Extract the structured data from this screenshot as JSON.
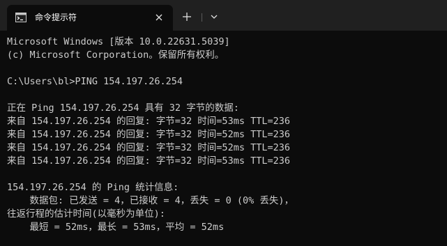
{
  "window": {
    "tab_icon": "terminal-icon",
    "tab_title": "命令提示符",
    "close_icon": "close-icon",
    "new_tab_icon": "plus-icon",
    "dropdown_icon": "chevron-down-icon"
  },
  "console": {
    "lines": [
      "Microsoft Windows [版本 10.0.22631.5039]",
      "(c) Microsoft Corporation。保留所有权利。",
      "",
      "C:\\Users\\bl>PING 154.197.26.254",
      "",
      "正在 Ping 154.197.26.254 具有 32 字节的数据:",
      "来自 154.197.26.254 的回复: 字节=32 时间=53ms TTL=236",
      "来自 154.197.26.254 的回复: 字节=32 时间=52ms TTL=236",
      "来自 154.197.26.254 的回复: 字节=32 时间=52ms TTL=236",
      "来自 154.197.26.254 的回复: 字节=32 时间=53ms TTL=236",
      "",
      "154.197.26.254 的 Ping 统计信息:",
      "    数据包: 已发送 = 4，已接收 = 4，丢失 = 0 (0% 丢失)，",
      "往返行程的估计时间(以毫秒为单位):",
      "    最短 = 52ms，最长 = 53ms，平均 = 52ms"
    ]
  }
}
